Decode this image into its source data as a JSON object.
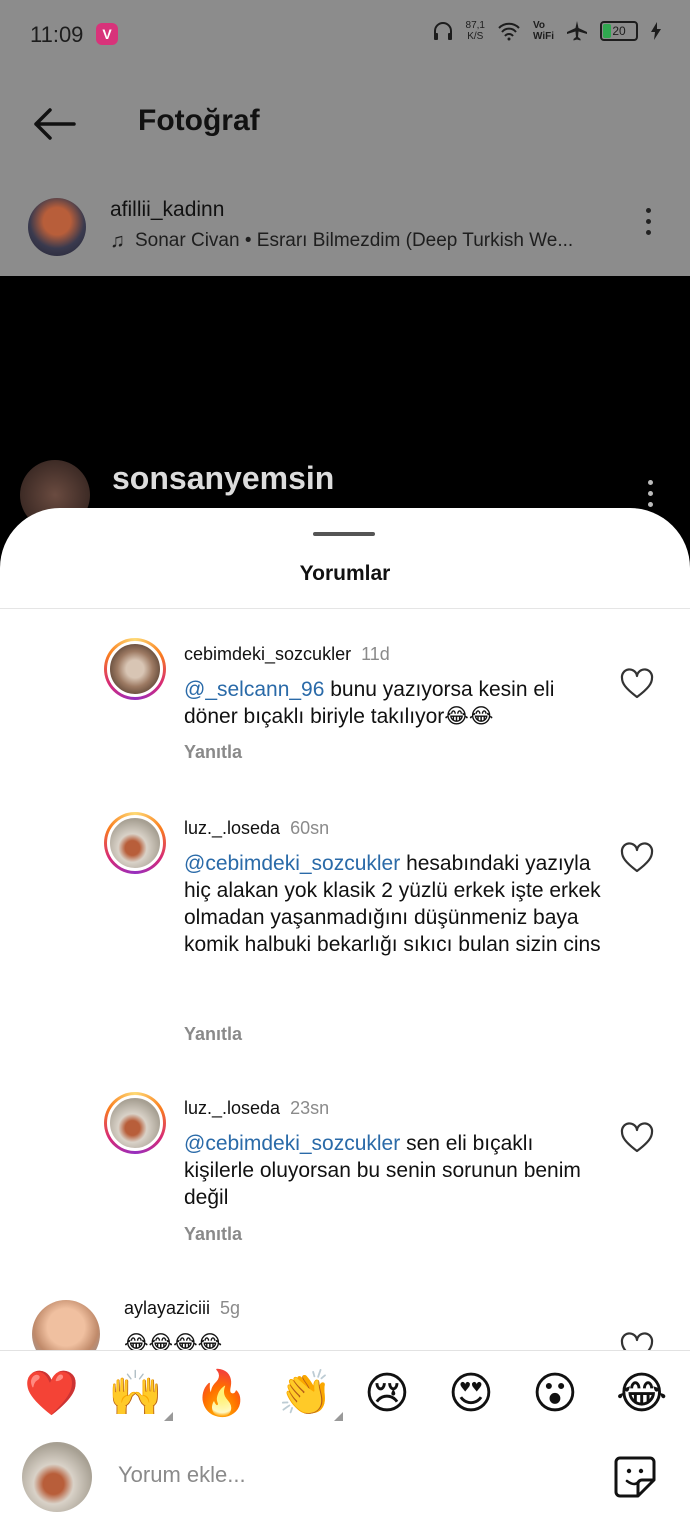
{
  "status_bar": {
    "time": "11:09",
    "app_badge": "V",
    "speed_value": "87,1",
    "speed_unit": "K/S",
    "vo": "Vo",
    "wifi_label": "WiFi",
    "battery": "20"
  },
  "header": {
    "title": "Fotoğraf"
  },
  "post": {
    "author": "afillii_kadinn",
    "music": "Sonar Civan • Esrarı Bilmezdim (Deep Turkish We..."
  },
  "background_post": {
    "username": "sonsanyemsin"
  },
  "sheet": {
    "title": "Yorumlar"
  },
  "comments": [
    {
      "user": "cebimdeki_sozcukler",
      "time": "11d",
      "mention": "@_selcann_96",
      "text": " bunu yazıyorsa kesin eli döner bıçaklı biriyle takılıyor😂😂",
      "reply": "Yanıtla"
    },
    {
      "user": "luz._.loseda",
      "time": "60sn",
      "mention": "@cebimdeki_sozcukler",
      "text": " hesabındaki yazıyla hiç alakan yok klasik 2 yüzlü erkek işte erkek olmadan yaşanmadığını düşünmeniz baya komik halbuki bekarlığı sıkıcı bulan sizin cins",
      "reply": "Yanıtla"
    },
    {
      "user": "luz._.loseda",
      "time": "23sn",
      "mention": "@cebimdeki_sozcukler",
      "text": " sen eli bıçaklı kişilerle oluyorsan bu senin sorunun benim değil",
      "reply": "Yanıtla"
    },
    {
      "user": "aylayaziciii",
      "time": "5g",
      "mention": "",
      "text": "😂😂😂😂",
      "reply": ""
    }
  ],
  "quick_reactions": [
    "❤️",
    "🙌",
    "🔥",
    "👏",
    "😢",
    "😍",
    "😮",
    "😂"
  ],
  "composer": {
    "placeholder": "Yorum ekle..."
  },
  "colors": {
    "mention": "#2a6aa8",
    "accent_ring": "#d62976"
  }
}
